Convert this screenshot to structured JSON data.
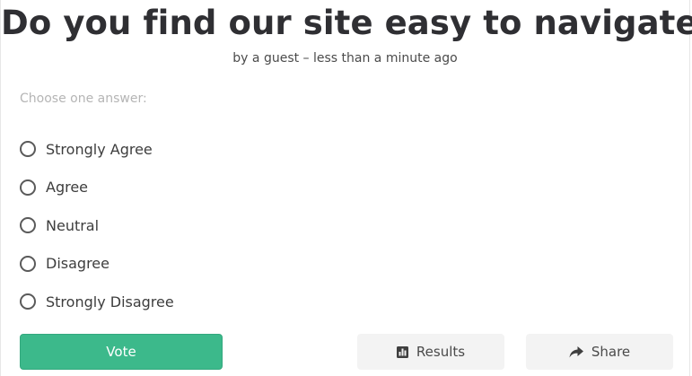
{
  "poll": {
    "title": "Do you find our site easy to navigate?",
    "byline": "by a guest – less than a minute ago",
    "prompt": "Choose one answer:"
  },
  "options": [
    {
      "label": "Strongly Agree"
    },
    {
      "label": "Agree"
    },
    {
      "label": "Neutral"
    },
    {
      "label": "Disagree"
    },
    {
      "label": "Strongly Disagree"
    }
  ],
  "buttons": {
    "vote_label": "Vote",
    "results_label": "Results",
    "results_icon": "bar-chart-icon",
    "share_label": "Share",
    "share_icon": "share-arrow-icon"
  },
  "colors": {
    "accent": "#3cb98b",
    "secondary_button": "#f3f3f3",
    "title": "#2f2f33"
  }
}
